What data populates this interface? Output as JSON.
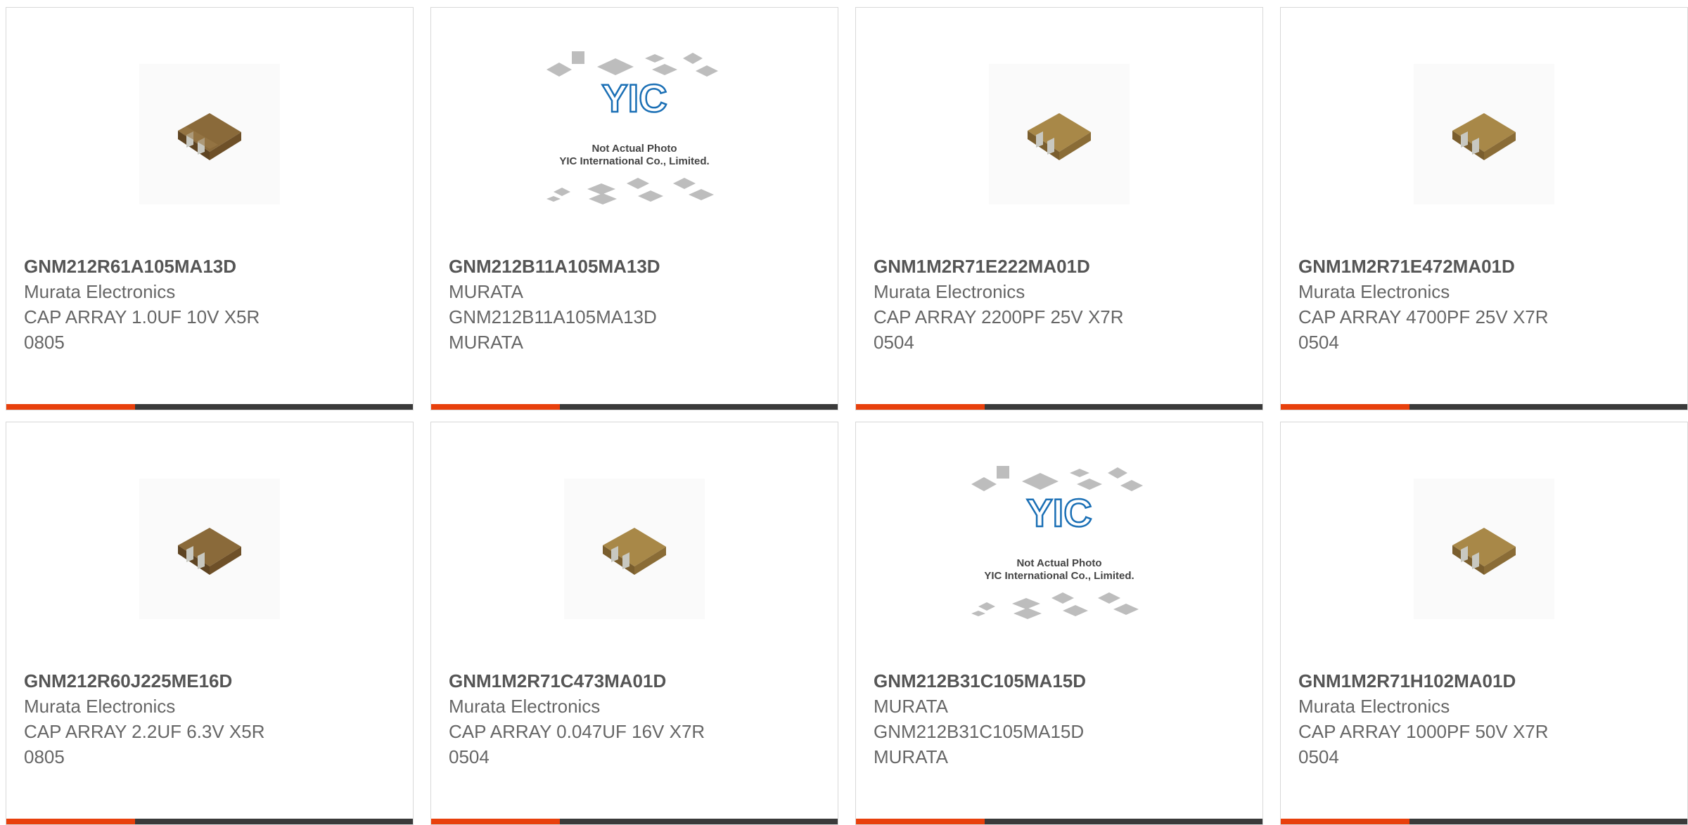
{
  "products": [
    {
      "mpn": "GNM212R61A105MA13D",
      "line1": "Murata Electronics",
      "line2": "CAP ARRAY 1.0UF 10V X5R",
      "line3": "0805",
      "image": "capacitor-chip-photo"
    },
    {
      "mpn": "GNM212B11A105MA13D",
      "line1": "MURATA",
      "line2": "GNM212B11A105MA13D",
      "line3": "MURATA",
      "image": "not-actual-photo-placeholder",
      "placeholder_line1": "Not Actual Photo",
      "placeholder_line2": "YIC International Co., Limited.",
      "placeholder_logo": "YIC"
    },
    {
      "mpn": "GNM1M2R71E222MA01D",
      "line1": "Murata Electronics",
      "line2": "CAP ARRAY 2200PF 25V X7R",
      "line3": "0504",
      "image": "capacitor-chip-photo"
    },
    {
      "mpn": "GNM1M2R71E472MA01D",
      "line1": "Murata Electronics",
      "line2": "CAP ARRAY 4700PF 25V X7R",
      "line3": "0504",
      "image": "capacitor-chip-photo"
    },
    {
      "mpn": "GNM212R60J225ME16D",
      "line1": "Murata Electronics",
      "line2": "CAP ARRAY 2.2UF 6.3V X5R",
      "line3": "0805",
      "image": "capacitor-chip-photo"
    },
    {
      "mpn": "GNM1M2R71C473MA01D",
      "line1": "Murata Electronics",
      "line2": "CAP ARRAY 0.047UF 16V X7R",
      "line3": "0504",
      "image": "capacitor-chip-photo"
    },
    {
      "mpn": "GNM212B31C105MA15D",
      "line1": "MURATA",
      "line2": "GNM212B31C105MA15D",
      "line3": "MURATA",
      "image": "not-actual-photo-placeholder",
      "placeholder_line1": "Not Actual Photo",
      "placeholder_line2": "YIC International Co., Limited.",
      "placeholder_logo": "YIC"
    },
    {
      "mpn": "GNM1M2R71H102MA01D",
      "line1": "Murata Electronics",
      "line2": "CAP ARRAY 1000PF 50V X7R",
      "line3": "0504",
      "image": "capacitor-chip-photo"
    }
  ],
  "colors": {
    "accent_bar": "#e8400c",
    "dark_bar": "#3a3a3a",
    "card_border": "#d8d8d8",
    "text": "#666666",
    "yic_logo": "#1a6fb5",
    "chip_body": "#7a5a2e"
  }
}
